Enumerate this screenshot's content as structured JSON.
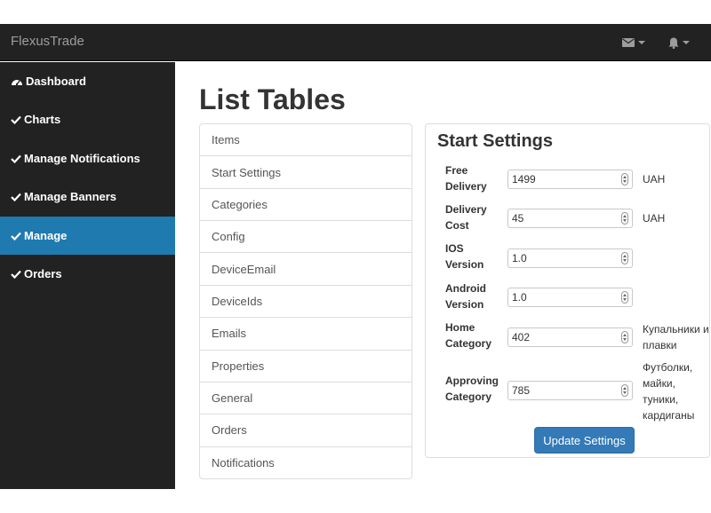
{
  "navbar": {
    "brand": "FlexusTrade",
    "icons": [
      "envelope-icon",
      "bell-icon"
    ]
  },
  "sidebar": {
    "items": [
      {
        "label": "Dashboard",
        "icon": "dashboard-icon",
        "active": false
      },
      {
        "label": "Charts",
        "icon": "check-icon",
        "active": false
      },
      {
        "label": "Manage Notifications",
        "icon": "check-icon",
        "active": false
      },
      {
        "label": "Manage Banners",
        "icon": "check-icon",
        "active": false
      },
      {
        "label": "Manage",
        "icon": "check-icon",
        "active": true
      },
      {
        "label": "Orders",
        "icon": "check-icon",
        "active": false
      }
    ],
    "active_color": "#1f7ab0"
  },
  "main": {
    "title": "List Tables",
    "list": [
      "Items",
      "Start Settings",
      "Categories",
      "Config",
      "DeviceEmail",
      "DeviceIds",
      "Emails",
      "Properties",
      "General",
      "Orders",
      "Notifications"
    ]
  },
  "settings": {
    "title": "Start Settings",
    "fields": [
      {
        "label": "Free Delivery",
        "value": "1499",
        "unit": "UAH"
      },
      {
        "label": "Delivery Cost",
        "value": "45",
        "unit": "UAH"
      },
      {
        "label": "IOS Version",
        "value": "1.0",
        "unit": ""
      },
      {
        "label": "Android Version",
        "value": "1.0",
        "unit": ""
      },
      {
        "label": "Home Category",
        "value": "402",
        "unit": "Купальники и плавки"
      },
      {
        "label": "Approving Category",
        "value": "785",
        "unit": "Футболки, майки, туники, кардиганы"
      }
    ],
    "button_label": "Update Settings",
    "button_color": "#337ab7"
  }
}
